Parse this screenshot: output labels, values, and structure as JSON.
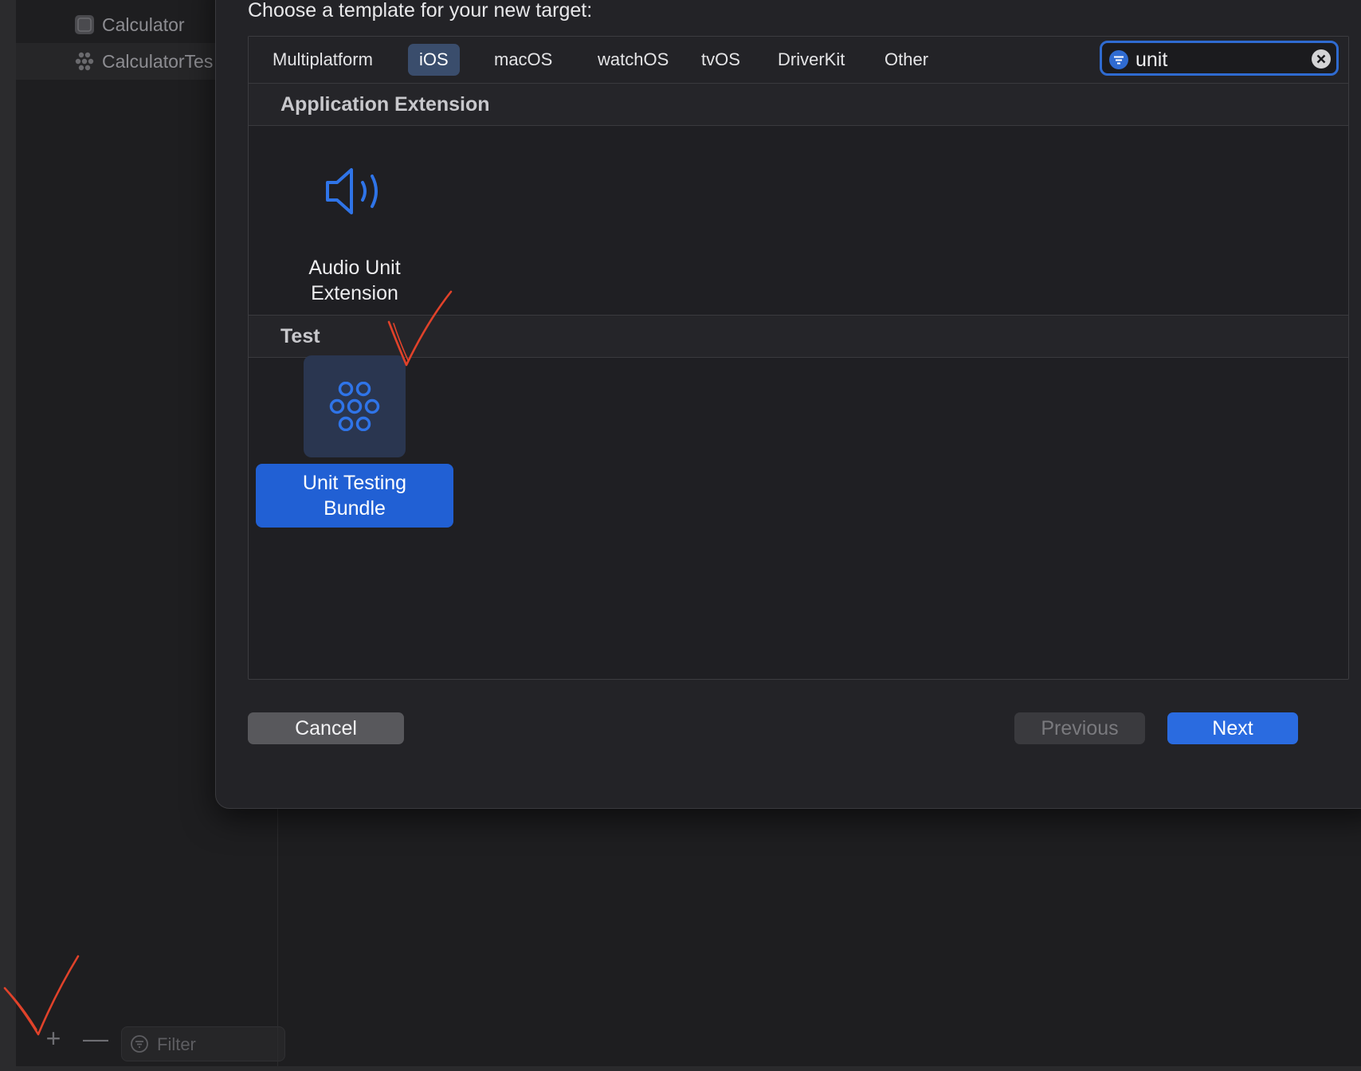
{
  "sidebar": {
    "items": [
      {
        "label": "Calculator",
        "icon": "app-target-icon"
      },
      {
        "label": "CalculatorTes",
        "icon": "test-target-icon"
      }
    ],
    "filter_placeholder": "Filter",
    "add_label": "+",
    "remove_label": "—"
  },
  "sheet": {
    "title": "Choose a template for your new target:",
    "platform_tabs": [
      {
        "label": "Multiplatform",
        "active": false
      },
      {
        "label": "iOS",
        "active": true
      },
      {
        "label": "macOS",
        "active": false
      },
      {
        "label": "watchOS",
        "active": false
      },
      {
        "label": "tvOS",
        "active": false
      },
      {
        "label": "DriverKit",
        "active": false
      },
      {
        "label": "Other",
        "active": false
      }
    ],
    "search": {
      "value": "unit"
    },
    "sections": [
      {
        "title": "Application Extension",
        "templates": [
          {
            "label_line1": "Audio Unit",
            "label_line2": "Extension",
            "icon": "speaker-icon",
            "selected": false
          }
        ]
      },
      {
        "title": "Test",
        "templates": [
          {
            "label_line1": "Unit Testing",
            "label_line2": "Bundle",
            "icon": "unit-test-icon",
            "selected": true
          }
        ]
      }
    ],
    "buttons": {
      "cancel": "Cancel",
      "previous": "Previous",
      "next": "Next"
    }
  },
  "colors": {
    "accent": "#2a6be0",
    "annotation": "#e0422a",
    "background": "#1e1e20"
  }
}
